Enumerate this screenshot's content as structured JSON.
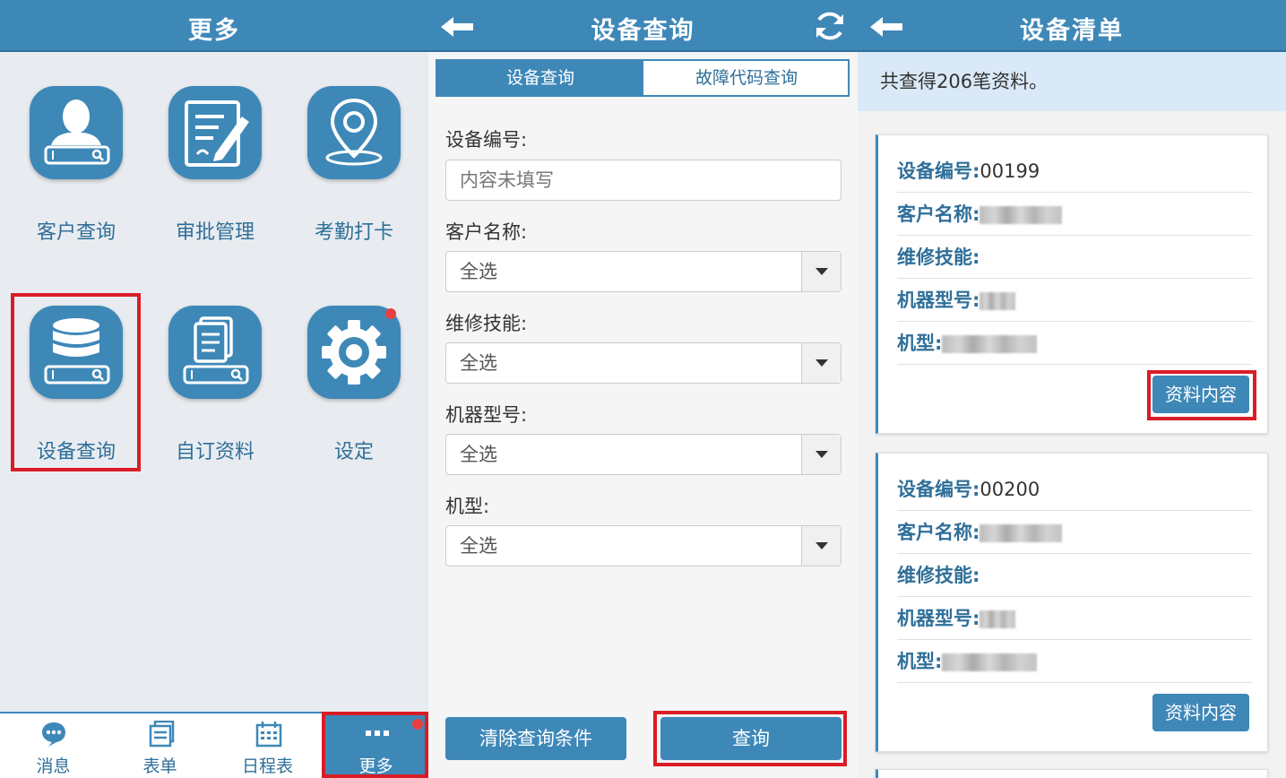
{
  "panel_more": {
    "title": "更多",
    "tiles": [
      {
        "label": "客户查询",
        "icon": "customer-search-icon"
      },
      {
        "label": "审批管理",
        "icon": "approval-icon"
      },
      {
        "label": "考勤打卡",
        "icon": "location-pin-icon"
      },
      {
        "label": "设备查询",
        "icon": "database-search-icon"
      },
      {
        "label": "自订资料",
        "icon": "document-search-icon"
      },
      {
        "label": "设定",
        "icon": "gear-icon"
      }
    ],
    "tabbar": [
      {
        "label": "消息",
        "icon": "chat-icon"
      },
      {
        "label": "表单",
        "icon": "forms-icon"
      },
      {
        "label": "日程表",
        "icon": "calendar-icon"
      },
      {
        "label": "更多",
        "icon": "more-dots-icon"
      }
    ]
  },
  "panel_query": {
    "title": "设备查询",
    "tabs": [
      "设备查询",
      "故障代码查询"
    ],
    "fields": {
      "device_no_label": "设备编号:",
      "device_no_placeholder": "内容未填写",
      "customer_label": "客户名称:",
      "customer_value": "全选",
      "skill_label": "维修技能:",
      "skill_value": "全选",
      "model_no_label": "机器型号:",
      "model_no_value": "全选",
      "model_label": "机型:",
      "model_value": "全选"
    },
    "clear_button": "清除查询条件",
    "query_button": "查询"
  },
  "panel_list": {
    "title": "设备清单",
    "summary": "共查得206笔资料。",
    "labels": {
      "device_no": "设备编号:",
      "customer": "客户名称:",
      "skill": "维修技能:",
      "model_no": "机器型号:",
      "model": "机型:"
    },
    "cards": [
      {
        "device_no": "00199",
        "detail_button": "资料内容"
      },
      {
        "device_no": "00200",
        "detail_button": "资料内容"
      }
    ]
  },
  "colors": {
    "primary": "#3e88b8",
    "highlight": "#d91c26",
    "badge": "#e84040"
  }
}
